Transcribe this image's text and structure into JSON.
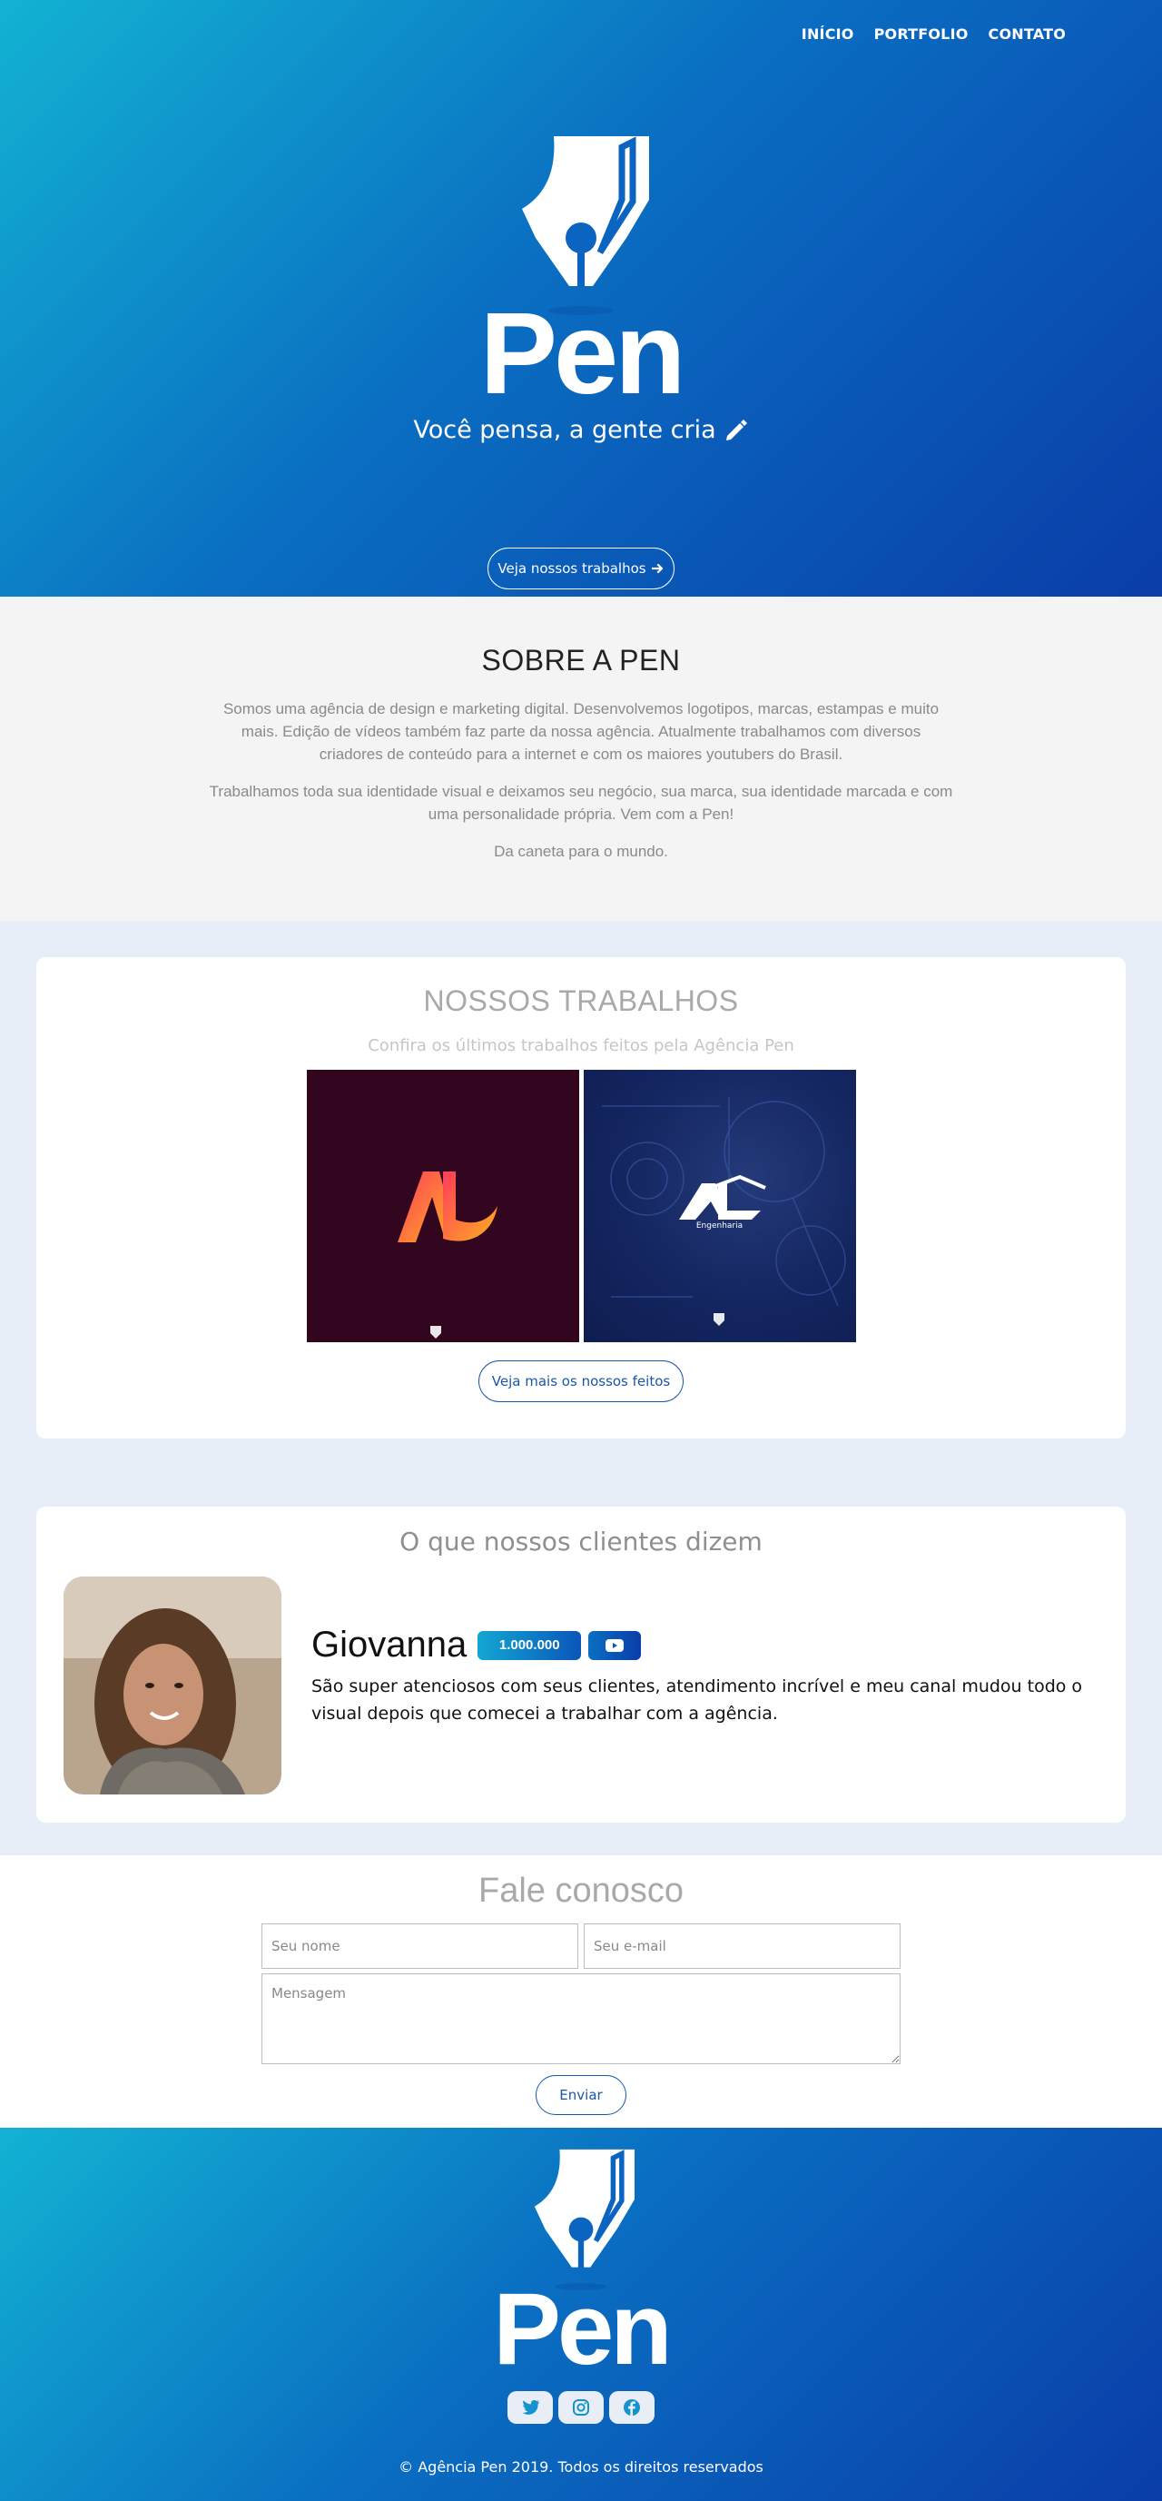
{
  "nav": {
    "items": [
      "INÍCIO",
      "PORTFOLIO",
      "CONTATO"
    ]
  },
  "hero": {
    "brand": "Pen",
    "tagline": "Você pensa, a gente cria",
    "tagline_icon": "pencil-icon",
    "cta_label": "Veja nossos trabalhos",
    "cta_icon": "arrow-right-icon"
  },
  "about": {
    "title": "SOBRE A PEN",
    "paragraphs": [
      "Somos uma agência de design e marketing digital. Desenvolvemos logotipos, marcas, estampas e muito mais. Edição de vídeos também faz parte da nossa agência. Atualmente trabalhamos com diversos criadores de conteúdo para a internet e com os maiores youtubers do Brasil.",
      "Trabalhamos toda sua identidade visual e deixamos seu negócio, sua marca, sua identidade marcada e com uma personalidade própria. Vem com a Pen!",
      "Da caneta para o mundo."
    ]
  },
  "works": {
    "title": "NOSSOS TRABALHOS",
    "subtitle": "Confira os últimos trabalhos feitos pela Agência Pen",
    "items": [
      {
        "logo_text": "AL",
        "caption": ""
      },
      {
        "logo_text": "AL",
        "caption": "Engenharia"
      }
    ],
    "more_label": "Veja mais os nossos feitos"
  },
  "testimonials": {
    "title": "O que nossos clientes dizem",
    "items": [
      {
        "name": "Giovanna",
        "badge": "1.000.000",
        "badge_icon": "youtube-icon",
        "text": "São super atenciosos com seus clientes, atendimento incrível e meu canal mudou todo o visual depois que comecei a trabalhar com a agência."
      }
    ]
  },
  "contact": {
    "title": "Fale conosco",
    "name_placeholder": "Seu nome",
    "email_placeholder": "Seu e-mail",
    "message_placeholder": "Mensagem",
    "submit_label": "Enviar"
  },
  "footer": {
    "brand": "Pen",
    "socials": [
      "twitter-icon",
      "instagram-icon",
      "facebook-icon"
    ],
    "copyright": "© Agência Pen 2019. Todos os direitos reservados"
  },
  "colors": {
    "gradient_start": "#13b2d3",
    "gradient_end": "#0a3da8",
    "accent_blue": "#1a56a8",
    "about_bg": "#f4f4f4",
    "works_bg": "#e8eef7"
  }
}
